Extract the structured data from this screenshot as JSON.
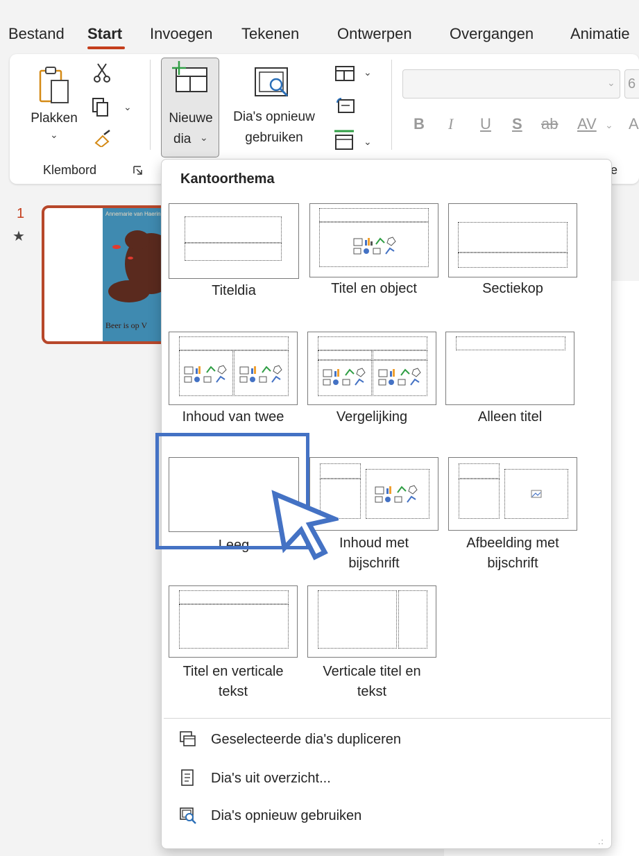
{
  "menubar": {
    "tabs": [
      {
        "label": "Bestand"
      },
      {
        "label": "Start",
        "active": true
      },
      {
        "label": "Invoegen"
      },
      {
        "label": "Tekenen"
      },
      {
        "label": "Ontwerpen"
      },
      {
        "label": "Overgangen"
      },
      {
        "label": "Animatie"
      }
    ],
    "active_color": "#c43e1c"
  },
  "ribbon": {
    "paste_label": "Plakken",
    "clipboard_group": "Klembord",
    "new_slide_line1": "Nieuwe",
    "new_slide_line2": "dia",
    "reuse_line1": "Dia's opnieuw",
    "reuse_line2": "gebruiken",
    "font_size_partial": "6",
    "format_buttons": [
      "B",
      "I",
      "U",
      "S",
      "ab",
      "AV",
      "A"
    ],
    "group_partial": "e"
  },
  "slides": {
    "number": "1",
    "star": "★",
    "thumb_author": "Annemarie van Haeringen",
    "thumb_title": "Beer is op V",
    "selected_color": "#b7472a"
  },
  "dropdown": {
    "heading": "Kantoorthema",
    "layouts": [
      {
        "label": "Titeldia"
      },
      {
        "label": "Titel en object"
      },
      {
        "label": "Sectiekop"
      },
      {
        "label": "Inhoud van twee"
      },
      {
        "label": "Vergelijking"
      },
      {
        "label": "Alleen titel"
      },
      {
        "label": "Leeg"
      },
      {
        "label_line1": "Inhoud met",
        "label_line2": "bijschrift"
      },
      {
        "label_line1": "Afbeelding met",
        "label_line2": "bijschrift"
      },
      {
        "label_line1": "Titel en verticale",
        "label_line2": "tekst"
      },
      {
        "label_line1": "Verticale titel en",
        "label_line2": "tekst"
      }
    ],
    "menu_items": [
      {
        "label": "Geselecteerde dia's dupliceren",
        "icon": "duplicate-slides-icon"
      },
      {
        "label": "Dia's uit overzicht...",
        "icon": "outline-document-icon"
      },
      {
        "label": "Dia's opnieuw gebruiken",
        "icon": "reuse-slides-icon"
      }
    ]
  },
  "overlay": {
    "highlight_color": "#4472c4",
    "cursor_icon": "pointer-arrow-icon"
  }
}
